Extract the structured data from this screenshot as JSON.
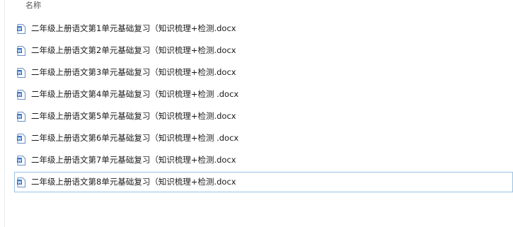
{
  "header": {
    "name_column": "名称"
  },
  "files": [
    {
      "name": "二年级上册语文第1单元基础复习（知识梳理+检测.docx",
      "icon": "word-document-icon"
    },
    {
      "name": "二年级上册语文第2单元基础复习（知识梳理+检测.docx",
      "icon": "word-document-icon"
    },
    {
      "name": "二年级上册语文第3单元基础复习（知识梳理+检测.docx",
      "icon": "word-document-icon"
    },
    {
      "name": "二年级上册语文第4单元基础复习（知识梳理+检测 .docx",
      "icon": "word-document-icon"
    },
    {
      "name": "二年级上册语文第5单元基础复习（知识梳理+检测.docx",
      "icon": "word-document-icon"
    },
    {
      "name": "二年级上册语文第6单元基础复习（知识梳理+检测 .docx",
      "icon": "word-document-icon"
    },
    {
      "name": "二年级上册语文第7单元基础复习（知识梳理+检测.docx",
      "icon": "word-document-icon"
    },
    {
      "name": "二年级上册语文第8单元基础复习（知识梳理+检测.docx",
      "icon": "word-document-icon",
      "selected": true
    }
  ],
  "colors": {
    "icon_blue": "#2b6cc4",
    "selection_border": "#99c2e6"
  }
}
